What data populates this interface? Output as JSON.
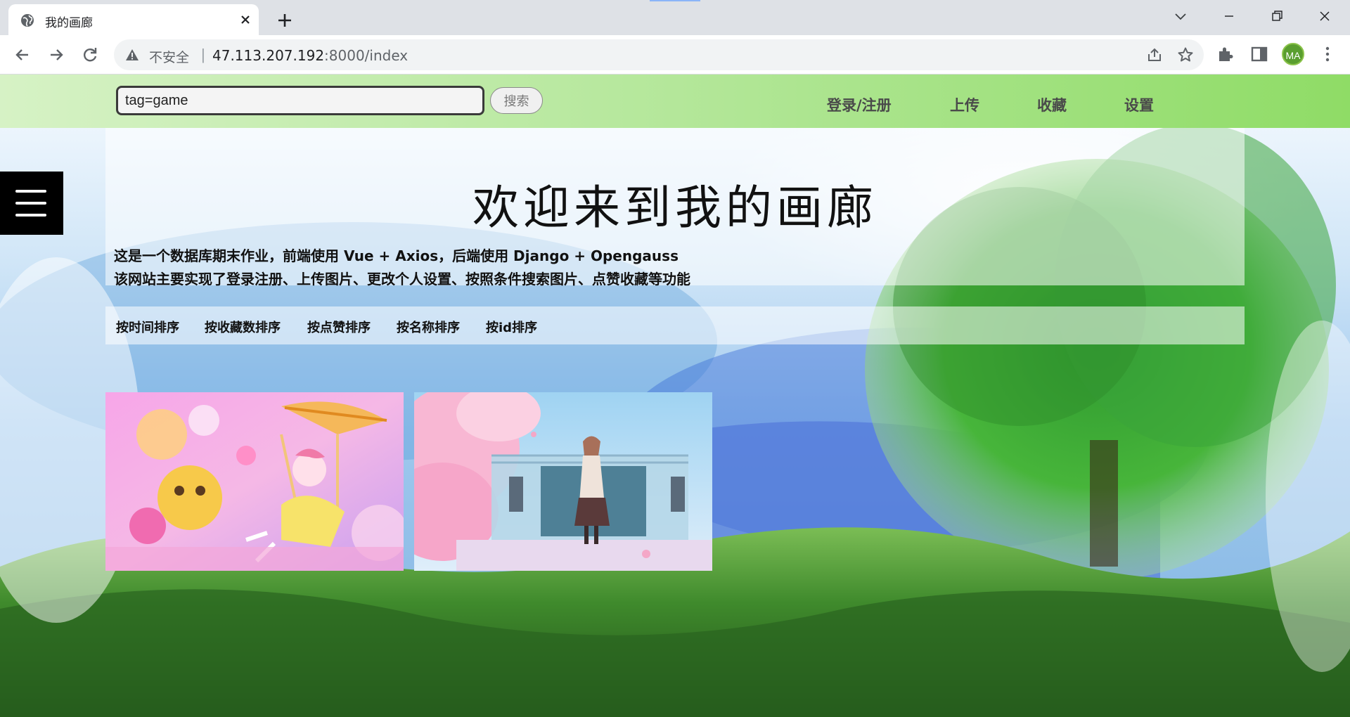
{
  "browser": {
    "tab_title": "我的画廊",
    "security_label": "不安全",
    "security_divider": "|",
    "url_host": "47.113.207.192",
    "url_path": ":8000/index",
    "profile_initials": "MA"
  },
  "colors": {
    "header_gradient_start": "#d6f2c5",
    "header_gradient_end": "#8fdc66",
    "avatar": "#5a9e2f"
  },
  "header": {
    "search_value": "tag=game",
    "search_button": "搜索",
    "nav": [
      {
        "label": "登录/注册"
      },
      {
        "label": "上传"
      },
      {
        "label": "收藏"
      },
      {
        "label": "设置"
      }
    ]
  },
  "hero": {
    "title": "欢迎来到我的画廊",
    "description_lines": [
      "这是一个数据库期末作业，前端使用 Vue + Axios，后端使用 Django + Opengauss",
      "该网站主要实现了登录注册、上传图片、更改个人设置、按照条件搜索图片、点赞收藏等功能"
    ]
  },
  "sort_options": [
    {
      "label": "按时间排序"
    },
    {
      "label": "按收藏数排序"
    },
    {
      "label": "按点赞排序"
    },
    {
      "label": "按名称排序"
    },
    {
      "label": "按id排序"
    }
  ],
  "gallery": [
    {
      "icon": "anime-artwork-carnival-swing"
    },
    {
      "icon": "anime-artwork-stage-cherry-blossom"
    }
  ]
}
